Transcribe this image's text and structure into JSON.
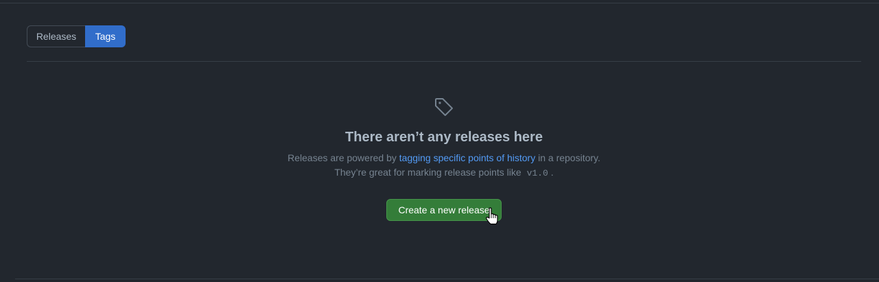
{
  "subnav": {
    "items": [
      {
        "label": "Releases",
        "selected": false
      },
      {
        "label": "Tags",
        "selected": true
      }
    ]
  },
  "blankslate": {
    "icon": "tag-icon",
    "title": "There aren’t any releases here",
    "desc_line1_prefix": "Releases are powered by ",
    "desc_line1_link": "tagging specific points of history",
    "desc_line1_suffix": " in a repository.",
    "desc_line2_prefix": "They’re great for marking release points like",
    "desc_line2_code": "v1.0",
    "desc_line2_suffix": ".",
    "button_label": "Create a new release"
  },
  "colors": {
    "background": "#22272e",
    "accent_blue": "#316dca",
    "link_blue": "#539bf5",
    "button_green": "#347d39"
  }
}
